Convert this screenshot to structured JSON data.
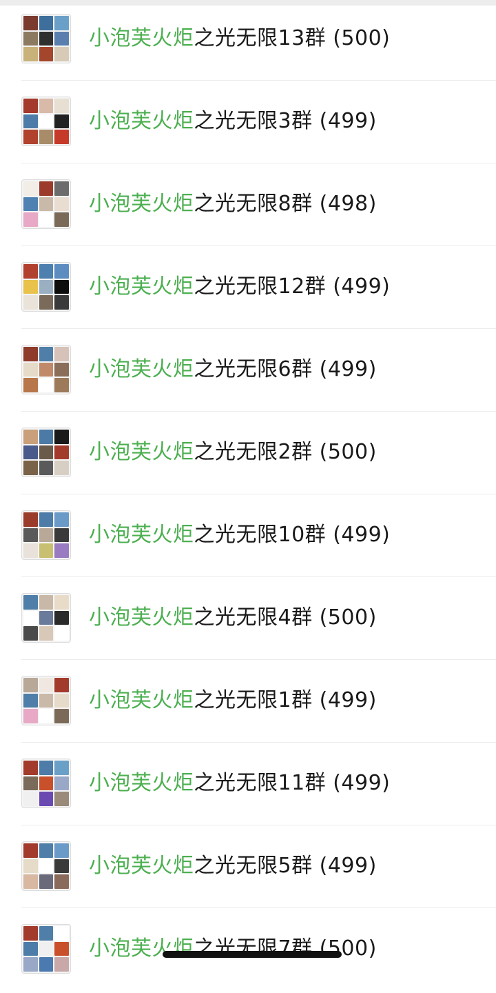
{
  "groups": [
    {
      "highlight": "小泡芙火炬",
      "rest": "之光无限13群 (500)",
      "tiles": [
        "#7a3b2e",
        "#3d6e9c",
        "#6aa0c8",
        "#8c7a60",
        "#2f2f2f",
        "#5a7fae",
        "#c9b27a",
        "#a3462c",
        "#d7cbb7"
      ]
    },
    {
      "highlight": "小泡芙火炬",
      "rest": "之光无限3群 (499)",
      "tiles": [
        "#a33a2b",
        "#d9b9a8",
        "#e7dfd2",
        "#4d7ca8",
        "#ffffff",
        "#222222",
        "#b0422e",
        "#a88c6a",
        "#c63a2a"
      ]
    },
    {
      "highlight": "小泡芙火炬",
      "rest": "之光无限8群 (498)",
      "tiles": [
        "#f2ede6",
        "#9c3b2c",
        "#6c6c6c",
        "#4f82b2",
        "#c9b9a8",
        "#e8ddd0",
        "#e8a9c6",
        "#ffffff",
        "#7c6a58"
      ]
    },
    {
      "highlight": "小泡芙火炬",
      "rest": "之光无限12群 (499)",
      "tiles": [
        "#b2402e",
        "#4d7faf",
        "#5c8cc0",
        "#e8c24a",
        "#9ab0c2",
        "#0d0d0d",
        "#e9e3da",
        "#7a6a5a",
        "#3a3a3a"
      ]
    },
    {
      "highlight": "小泡芙火炬",
      "rest": "之光无限6群 (499)",
      "tiles": [
        "#8e3b2c",
        "#4f7ea8",
        "#d6c2b8",
        "#e6dbc8",
        "#c08a6a",
        "#8a6e5a",
        "#b7774a",
        "#ffffff",
        "#9c7a5a"
      ]
    },
    {
      "highlight": "小泡芙火炬",
      "rest": "之光无限2群 (500)",
      "tiles": [
        "#caa07a",
        "#4c7aa6",
        "#1a1a1a",
        "#4a5a8a",
        "#6a5a4a",
        "#a33b2c",
        "#7a6248",
        "#5a5a5a",
        "#d8cfc4"
      ]
    },
    {
      "highlight": "小泡芙火炬",
      "rest": "之光无限10群 (499)",
      "tiles": [
        "#9a3b2c",
        "#4d7ca8",
        "#6a9ac8",
        "#5a5a5a",
        "#b8a898",
        "#3a3a3a",
        "#e8e2da",
        "#c8c070",
        "#9a7ac0"
      ]
    },
    {
      "highlight": "小泡芙火炬",
      "rest": "之光无限4群 (500)",
      "tiles": [
        "#4f7ea8",
        "#c8b8a8",
        "#e8dcc8",
        "#ffffff",
        "#6a7a9a",
        "#2a2a2a",
        "#4a4a4a",
        "#d8c8b8",
        "#ffffff"
      ]
    },
    {
      "highlight": "小泡芙火炬",
      "rest": "之光无限1群 (499)",
      "tiles": [
        "#b8a898",
        "#f0e8e0",
        "#a33b2c",
        "#4f7ea8",
        "#c9b9a8",
        "#e6dbc8",
        "#e8a9c6",
        "#ffffff",
        "#7c6a58"
      ]
    },
    {
      "highlight": "小泡芙火炬",
      "rest": "之光无限11群 (499)",
      "tiles": [
        "#a33b2c",
        "#4d7ca8",
        "#6aa0c8",
        "#7a6a5a",
        "#c8502a",
        "#9aa8c8",
        "#f0f0f0",
        "#6a4ab0",
        "#9a8a7a"
      ]
    },
    {
      "highlight": "小泡芙火炬",
      "rest": "之光无限5群 (499)",
      "tiles": [
        "#a33b2c",
        "#4f7ea8",
        "#6a9ac8",
        "#e6dbc8",
        "#ffffff",
        "#3a3a3a",
        "#d8b8a0",
        "#6a6a7a",
        "#8a6a5a"
      ]
    },
    {
      "highlight": "小泡芙火炬",
      "rest": "之光无限7群 (500)",
      "tiles": [
        "#a33b2c",
        "#4f7ea8",
        "#ffffff",
        "#4d7ca8",
        "#f0f0f0",
        "#c8502a",
        "#9aa8c8",
        "#4a7ab0",
        "#c8a8a8"
      ]
    }
  ]
}
